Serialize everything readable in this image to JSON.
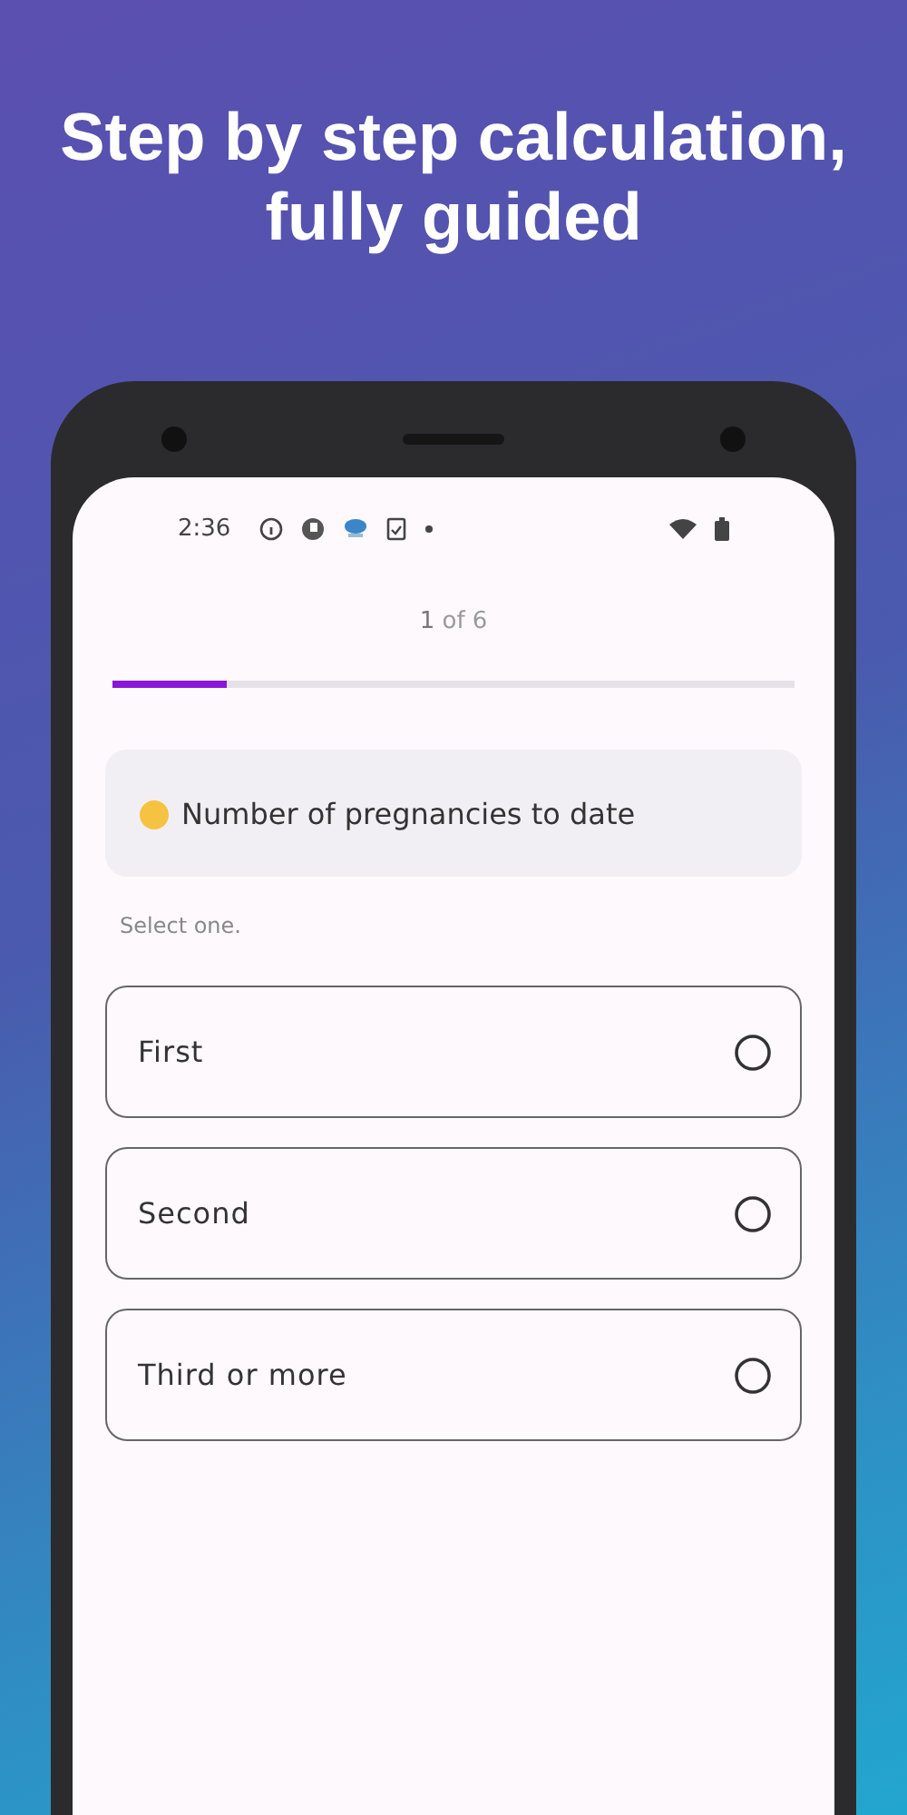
{
  "headline": "Step by step calculation, fully guided",
  "status_bar": {
    "time": "2:36"
  },
  "progress": {
    "current": "1",
    "total_text": "of 6",
    "level": 0.167
  },
  "question": {
    "text": "Number of pregnancies to date"
  },
  "hint": "Select one.",
  "options": [
    {
      "label": "First",
      "selected": false
    },
    {
      "label": "Second",
      "selected": false
    },
    {
      "label": "Third or more",
      "selected": false
    }
  ]
}
